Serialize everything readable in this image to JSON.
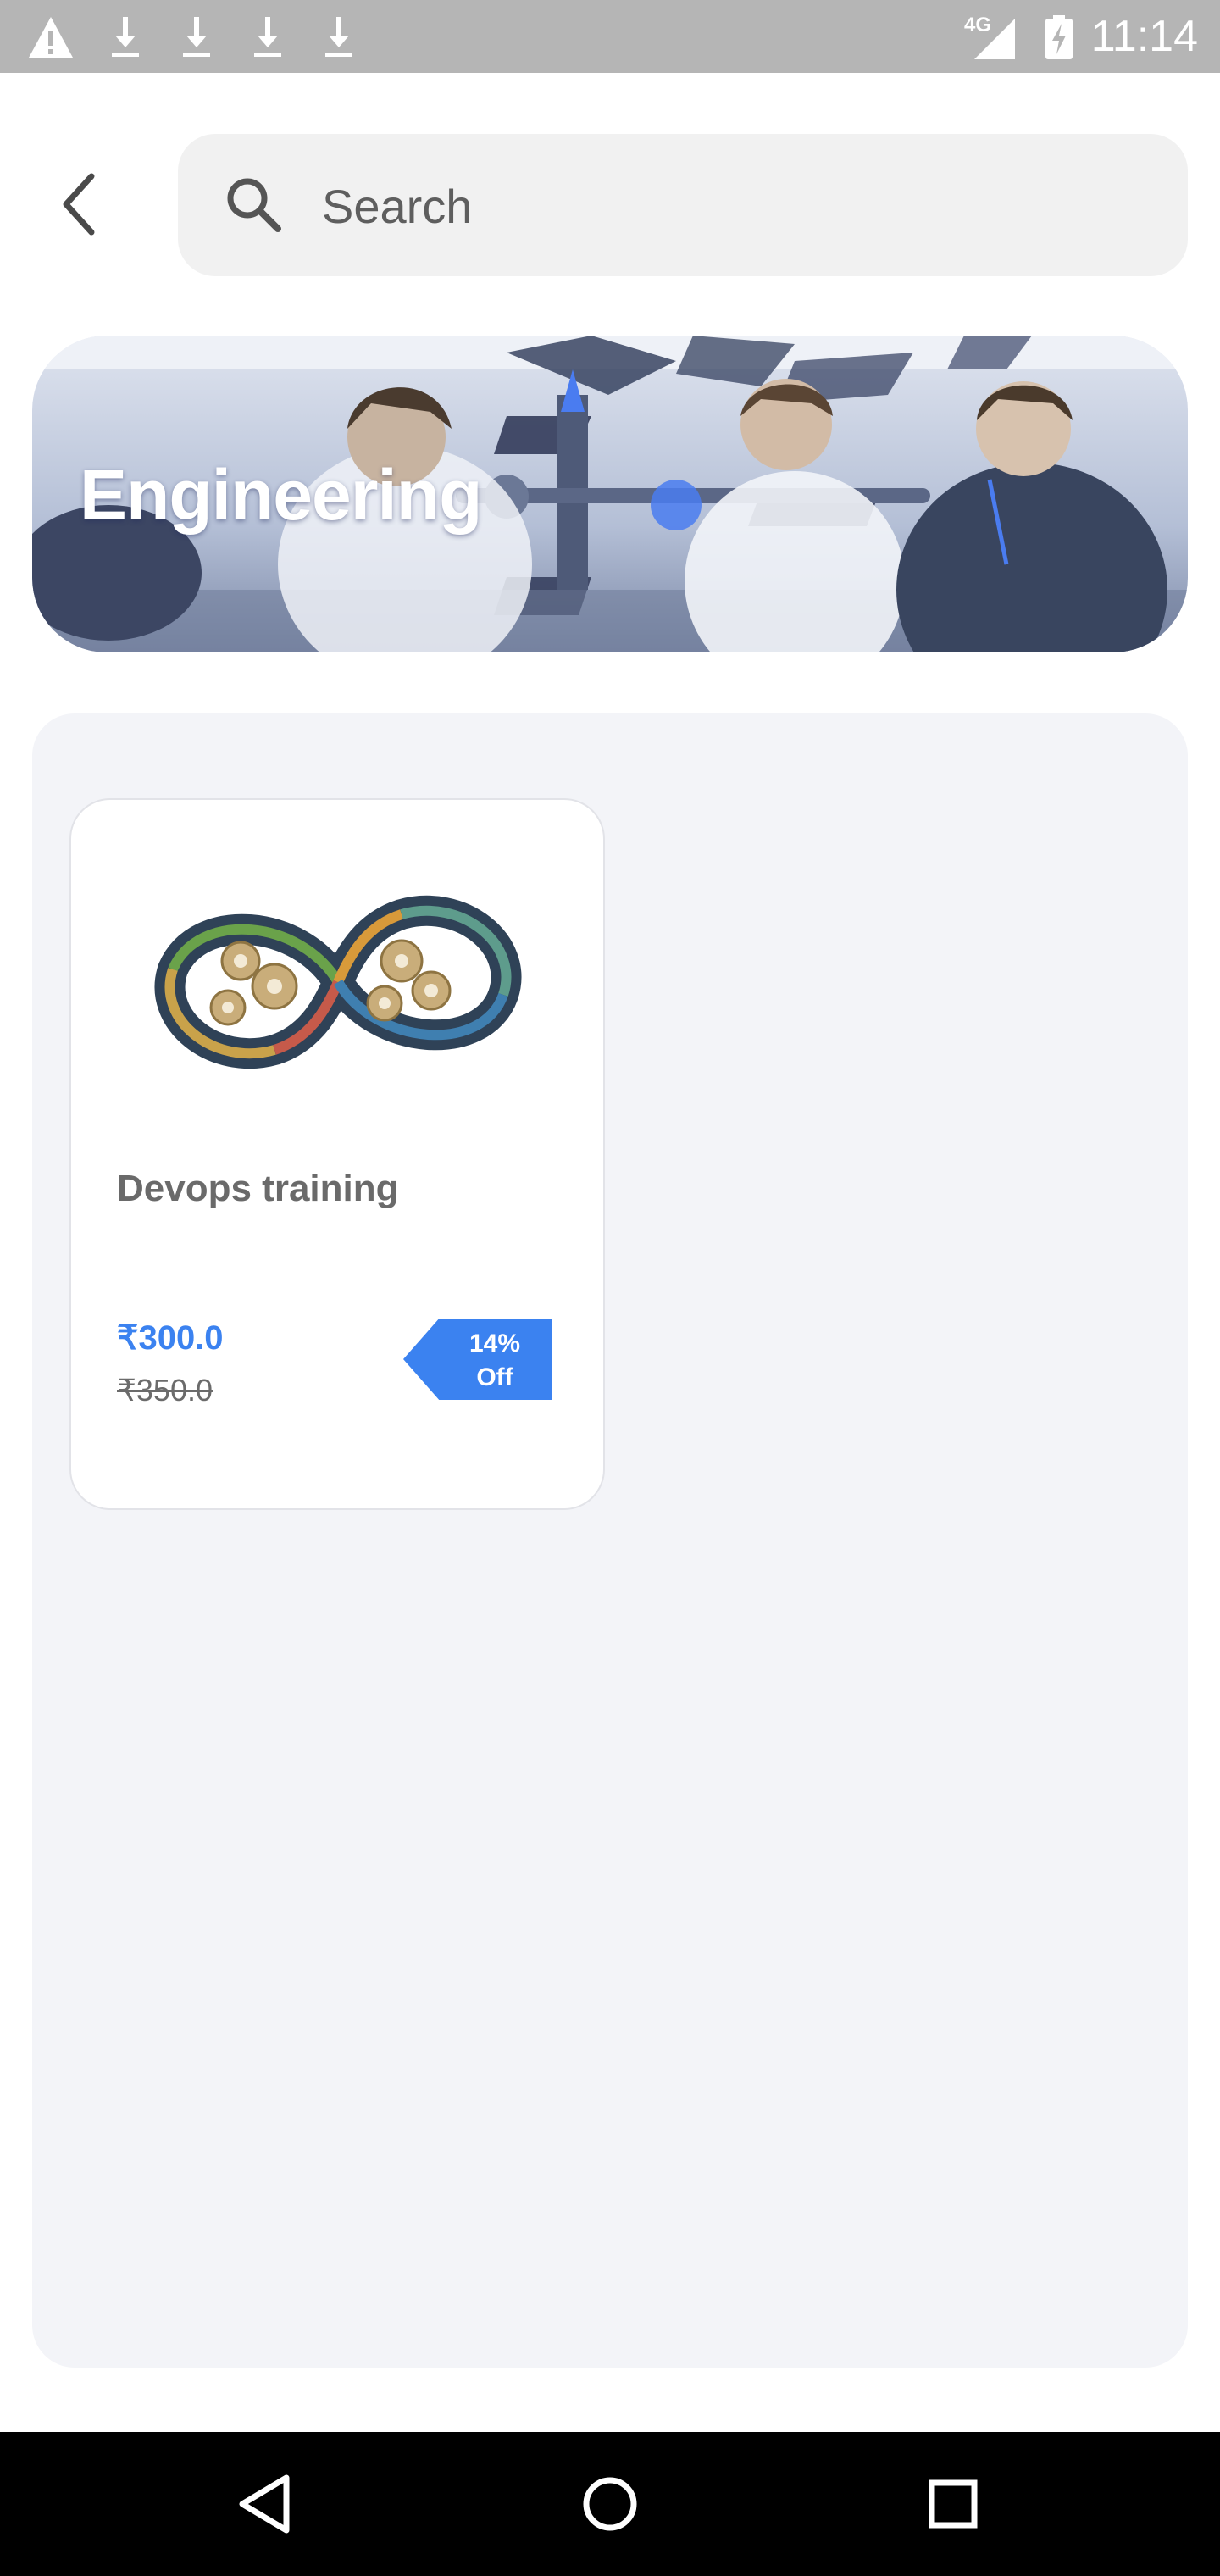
{
  "status_bar": {
    "time": "11:14",
    "network": "4G",
    "icons": [
      "warning-icon",
      "download-icon",
      "download-icon",
      "download-icon",
      "download-icon",
      "signal-icon",
      "battery-charging-icon"
    ]
  },
  "header": {
    "back_icon": "chevron-left-icon",
    "search": {
      "placeholder": "Search",
      "value": "",
      "icon": "search-icon"
    }
  },
  "banner": {
    "title": "Engineering"
  },
  "products": [
    {
      "name": "Devops training",
      "price": "₹300.0",
      "original_price": "₹350.0",
      "discount_line1": "14%",
      "discount_line2": "Off",
      "image_icon": "devops-infinity-icon"
    }
  ],
  "nav_bar": {
    "buttons": [
      "back-triangle-icon",
      "home-circle-icon",
      "recents-square-icon"
    ]
  },
  "colors": {
    "accent": "#3b82f0",
    "status_bar": "#b5b5b5",
    "panel_bg": "#f3f4f8",
    "nav_bar": "#000000"
  }
}
